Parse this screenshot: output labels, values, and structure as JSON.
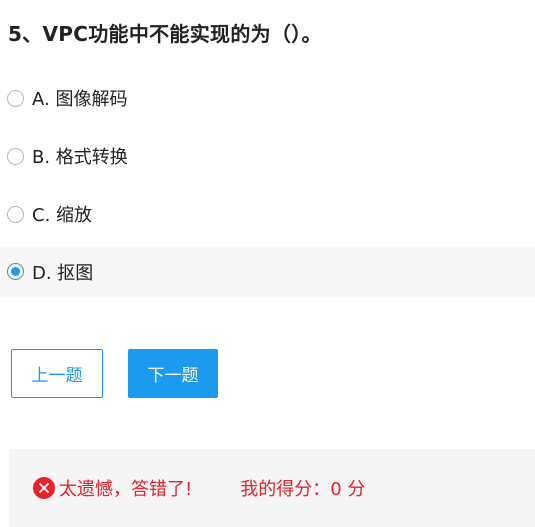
{
  "question": {
    "title": "5、VPC功能中不能实现的为（）。"
  },
  "options": [
    {
      "label": "A. 图像解码",
      "selected": false
    },
    {
      "label": "B. 格式转换",
      "selected": false
    },
    {
      "label": "C. 缩放",
      "selected": false
    },
    {
      "label": "D. 抠图",
      "selected": true
    }
  ],
  "buttons": {
    "prev_label": "上一题",
    "next_label": "下一题"
  },
  "result": {
    "message": "太遗憾，答错了!",
    "score_text": "我的得分：0 分"
  },
  "colors": {
    "accent": "#1b9aee",
    "error": "#e8212d",
    "result_background": "#f5f5f5",
    "selected_option_background": "#f7f7f7"
  },
  "icons": {
    "result_icon": "close-circle-icon"
  }
}
